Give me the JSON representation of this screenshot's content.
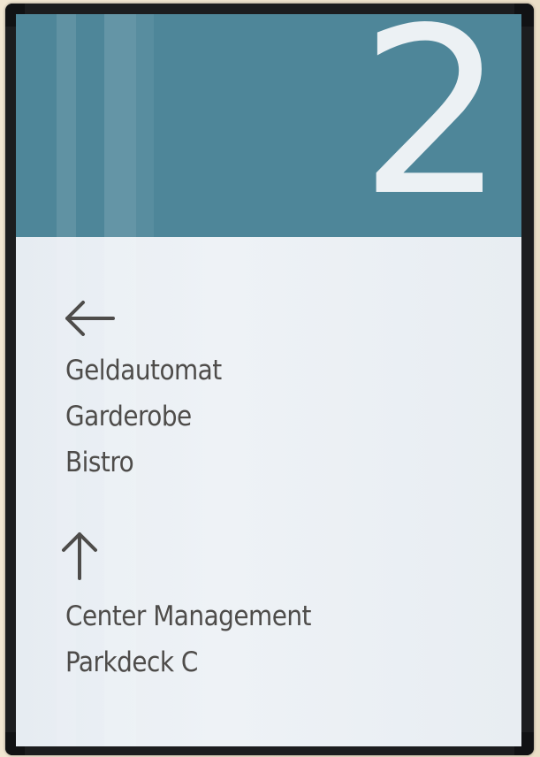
{
  "sign": {
    "floor_number": "2",
    "header_color": "#4e8699",
    "panel_color": "#eaeff3",
    "text_color": "#4e4c4a",
    "groups": [
      {
        "direction_icon": "arrow-left-icon",
        "destinations": [
          "Geldautomat",
          "Garderobe",
          "Bistro"
        ]
      },
      {
        "direction_icon": "arrow-up-icon",
        "destinations": [
          "Center Management",
          "Parkdeck C"
        ]
      }
    ]
  }
}
